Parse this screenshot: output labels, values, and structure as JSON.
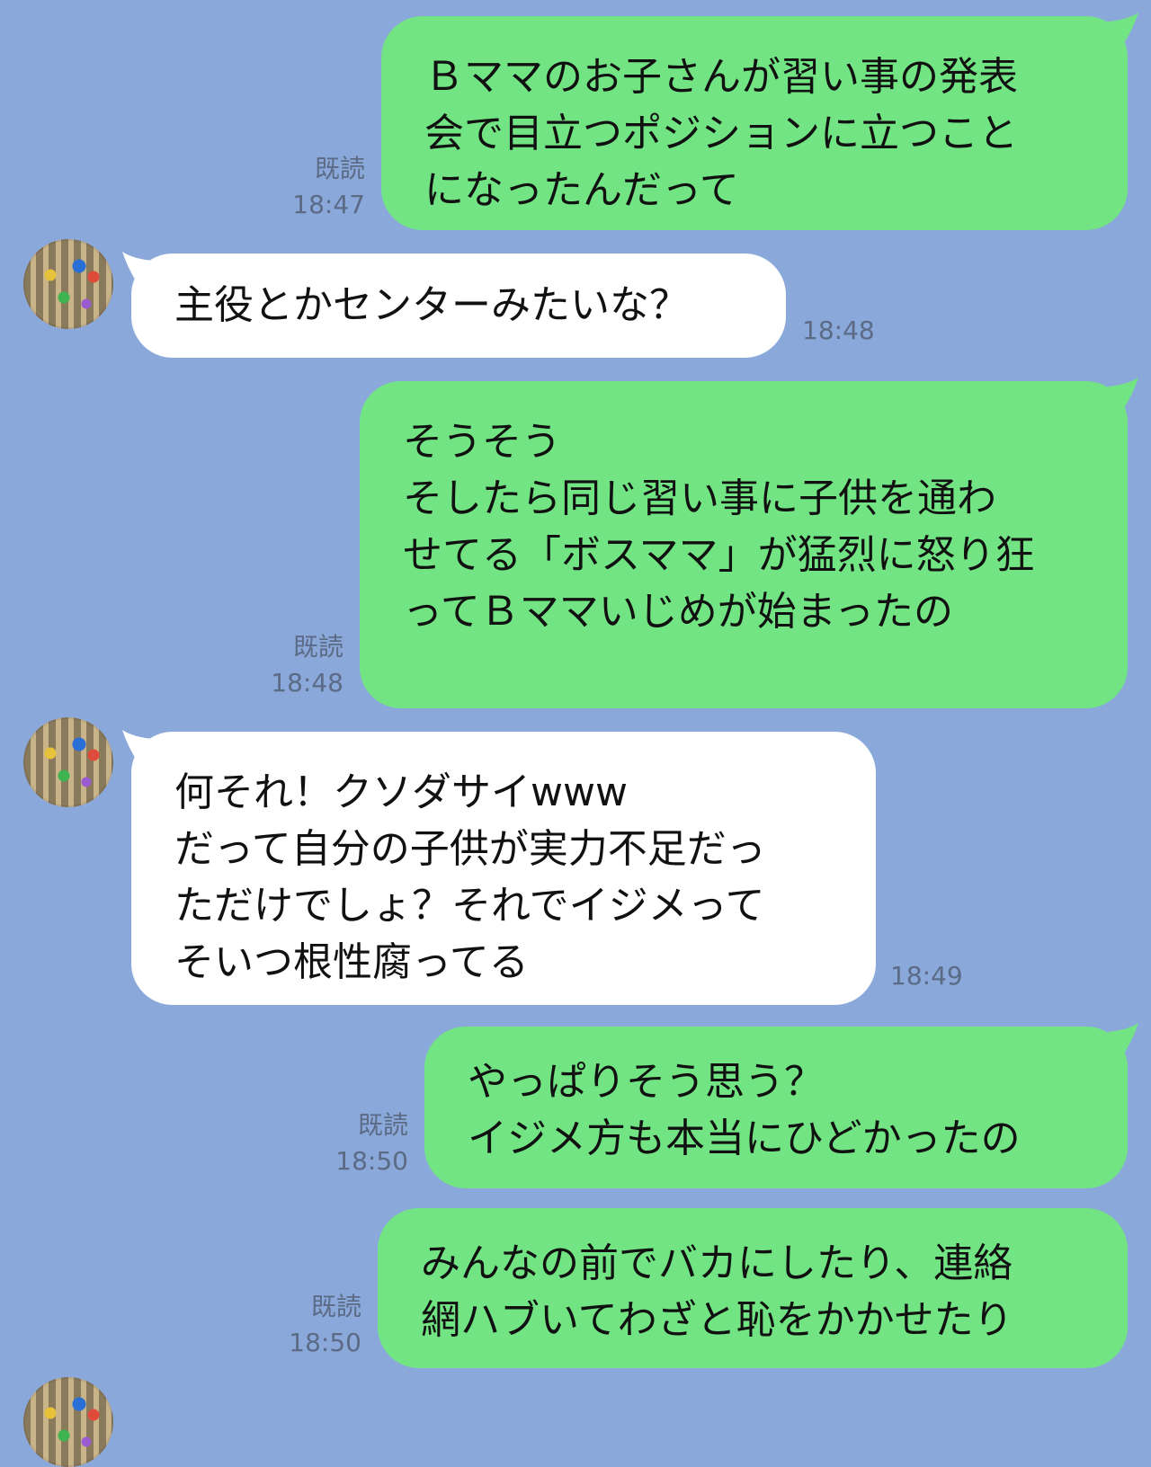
{
  "colors": {
    "background": "#8aa8da",
    "outgoing_bubble": "#72e484",
    "incoming_bubble": "#ffffff",
    "meta_text": "#5b6b85"
  },
  "messages": [
    {
      "direction": "out",
      "text": "Ｂママのお子さんが習い事の発表\n会で目立つポジションに立つこと\nになったんだって",
      "read_label": "既読",
      "time": "18:47"
    },
    {
      "direction": "in",
      "avatar_icon": "profile-photo",
      "text": "主役とかセンターみたいな？",
      "time": "18:48"
    },
    {
      "direction": "out",
      "text": "そうそう\nそしたら同じ習い事に子供を通わ\nせてる「ボスママ」が猛烈に怒り狂\nってＢママいじめが始まったの",
      "read_label": "既読",
      "time": "18:48"
    },
    {
      "direction": "in",
      "avatar_icon": "profile-photo",
      "text": "何それ！クソダサイwww\nだって自分の子供が実力不足だっ\nただけでしょ？それでイジメって\nそいつ根性腐ってる",
      "time": "18:49"
    },
    {
      "direction": "out",
      "text": "やっぱりそう思う？\nイジメ方も本当にひどかったの",
      "read_label": "既読",
      "time": "18:50"
    },
    {
      "direction": "out",
      "text": "みんなの前でバカにしたり、連絡\n網ハブいてわざと恥をかかせたり",
      "read_label": "既読",
      "time": "18:50"
    }
  ]
}
